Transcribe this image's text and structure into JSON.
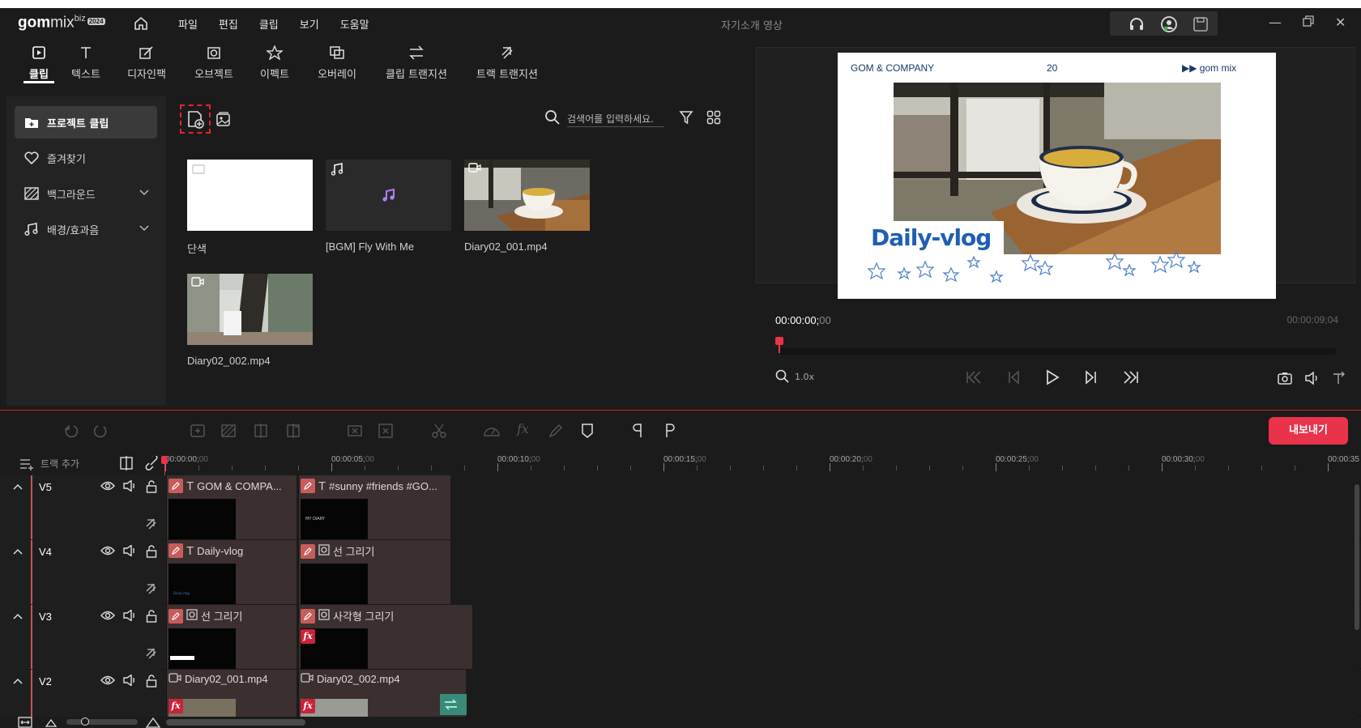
{
  "app": {
    "logo_gom": "gom",
    "logo_mix": "mix",
    "logo_biz": "biz",
    "logo_badge": "2024",
    "doc_title": "자기소개 영상"
  },
  "menu": [
    "파일",
    "편집",
    "클립",
    "보기",
    "도움말"
  ],
  "tabs": [
    {
      "label": "클립",
      "active": true
    },
    {
      "label": "텍스트"
    },
    {
      "label": "디자인팩"
    },
    {
      "label": "오브젝트"
    },
    {
      "label": "이펙트"
    },
    {
      "label": "오버레이"
    },
    {
      "label": "클립 트랜지션"
    },
    {
      "label": "트랙 트랜지션"
    }
  ],
  "sidebar": {
    "items": [
      {
        "label": "프로젝트 클립"
      },
      {
        "label": "즐겨찾기"
      },
      {
        "label": "백그라운드"
      },
      {
        "label": "배경/효과음"
      }
    ]
  },
  "library": {
    "search_placeholder": "검색어를 입력하세요.",
    "clips": [
      {
        "label": "단색"
      },
      {
        "label": "[BGM] Fly With Me"
      },
      {
        "label": "Diary02_001.mp4"
      },
      {
        "label": "Diary02_002.mp4"
      }
    ]
  },
  "preview": {
    "header_left": "GOM & COMPANY",
    "header_mid": "20",
    "header_right": "▶▶ gom mix",
    "vlog_text": "Daily-vlog",
    "timecode_main": "00:00:00;",
    "timecode_frames": "00",
    "timecode_total": "00:00:09;04",
    "zoom": "1.0x"
  },
  "toolbar": {
    "export_label": "내보내기"
  },
  "timeline": {
    "add_track": "트랙 추가",
    "ruler": [
      {
        "t": "00:00:00;",
        "f": "00"
      },
      {
        "t": "00:00:05;",
        "f": "00"
      },
      {
        "t": "00:00:10;",
        "f": "00"
      },
      {
        "t": "00:00:15;",
        "f": "00"
      },
      {
        "t": "00:00:20;",
        "f": "00"
      },
      {
        "t": "00:00:25;",
        "f": "00"
      },
      {
        "t": "00:00:30;",
        "f": "00"
      },
      {
        "t": "00:00:35",
        "f": ""
      }
    ],
    "tracks": [
      {
        "name": "V5",
        "clips": [
          {
            "label": "GOM & COMPA..."
          },
          {
            "label": "#sunny #friends #GO..."
          }
        ]
      },
      {
        "name": "V4",
        "clips": [
          {
            "label": "Daily-vlog"
          },
          {
            "label": "선 그리기"
          }
        ]
      },
      {
        "name": "V3",
        "clips": [
          {
            "label": "선 그리기"
          },
          {
            "label": "사각형 그리기"
          }
        ]
      },
      {
        "name": "V2",
        "clips": [
          {
            "label": "Diary02_001.mp4"
          },
          {
            "label": "Diary02_002.mp4"
          }
        ]
      }
    ],
    "mini_clip_text": "MY DIARY",
    "mini_vlog_text": "Daily-vlog"
  }
}
